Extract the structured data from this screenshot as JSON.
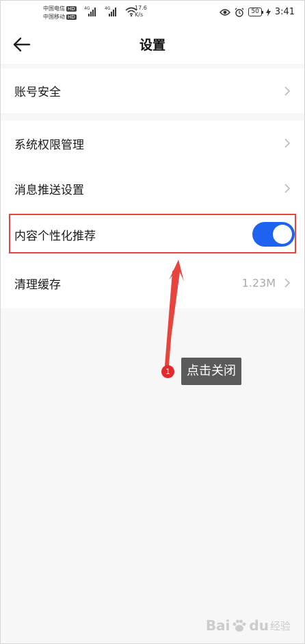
{
  "status_bar": {
    "carrier_1": "中国电信",
    "carrier_2": "中国移动",
    "hd_badge": "HD",
    "network_1": "4G",
    "network_2": "4G",
    "speed_value": "17.6",
    "speed_unit": "K/s",
    "battery": "50",
    "time": "3:41",
    "icons": [
      "eye-icon",
      "alarm-icon",
      "charging-icon",
      "wifi-icon",
      "signal-icon"
    ]
  },
  "nav": {
    "title": "设置",
    "back_icon": "arrow-left-icon"
  },
  "settings": {
    "group_1": [
      {
        "label": "账号安全"
      }
    ],
    "group_2": [
      {
        "label": "系统权限管理"
      },
      {
        "label": "消息推送设置"
      },
      {
        "label": "内容个性化推荐",
        "toggle_on": true
      },
      {
        "label": "清理缓存",
        "value": "1.23M"
      }
    ]
  },
  "annotation": {
    "step_number": "1",
    "tip": "点击关闭"
  },
  "watermark": {
    "brand": "Bai",
    "brand_end": "du",
    "sub": "经验"
  },
  "colors": {
    "accent": "#1d63f0",
    "annotation_red": "#e8443e",
    "background": "#f7f7f7",
    "tip_bg": "#5a5a5a"
  }
}
